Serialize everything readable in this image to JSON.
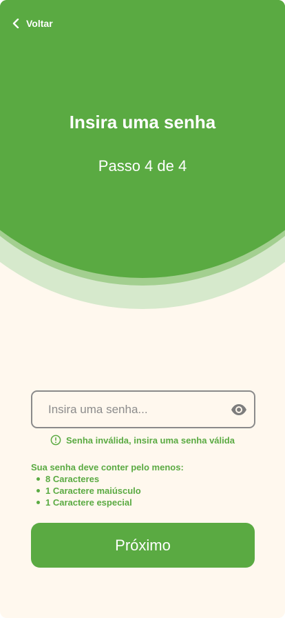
{
  "header": {
    "back_label": "Voltar",
    "title": "Insira uma senha",
    "step": "Passo 4 de 4"
  },
  "form": {
    "password_placeholder": "Insira uma senha...",
    "password_value": "",
    "error_message": "Senha inválida, insira uma senha válida"
  },
  "requirements": {
    "title": "Sua senha deve conter pelo menos:",
    "items": [
      "8 Caracteres",
      "1 Caractere maiúsculo",
      "1 Caractere especial"
    ]
  },
  "actions": {
    "next_label": "Próximo"
  },
  "colors": {
    "primary": "#5aaa42",
    "arc_mid": "#a3cf90",
    "arc_light": "#d6e9cc",
    "background": "#fff8ee",
    "field_border": "#8a8a8a"
  },
  "icons": {
    "back": "chevron-left-icon",
    "visibility": "eye-icon",
    "error": "alert-circle-icon"
  }
}
